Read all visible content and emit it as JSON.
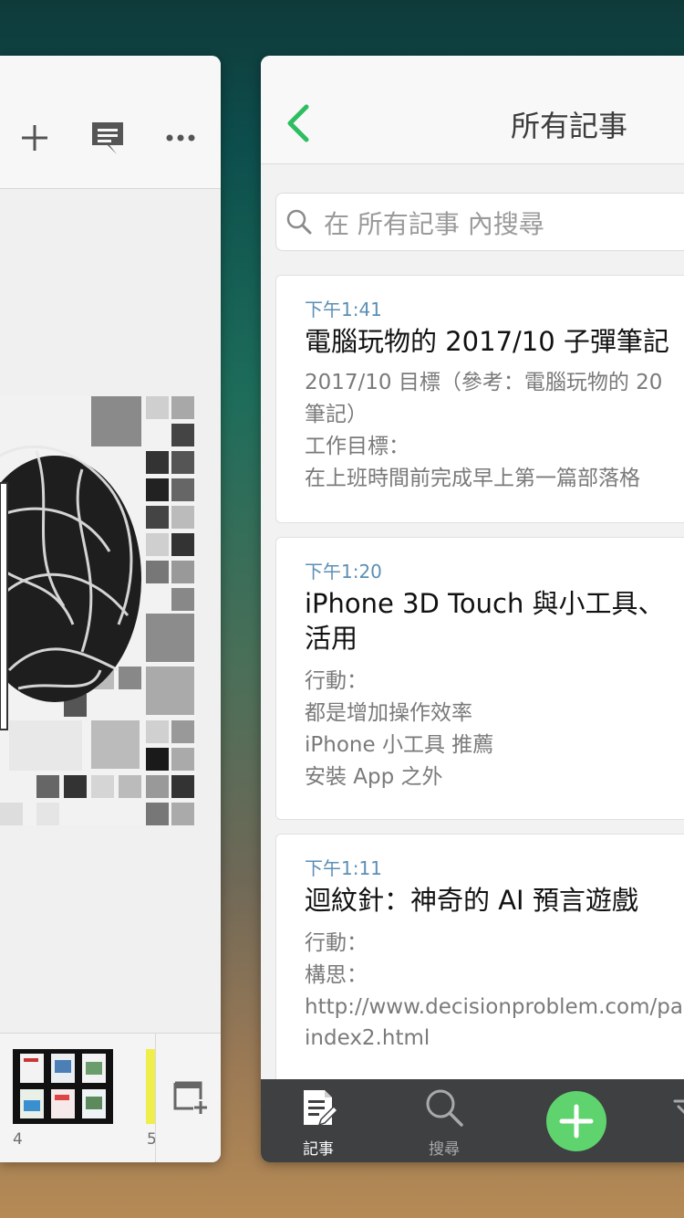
{
  "left_app": {
    "toolbar_icons": [
      "plus-icon",
      "comment-icon",
      "more-icon"
    ],
    "bottom": {
      "page_labels": [
        "4",
        "5"
      ]
    }
  },
  "right_app": {
    "nav": {
      "title": "所有記事"
    },
    "search": {
      "placeholder": "在 所有記事 內搜尋"
    },
    "notes": [
      {
        "time": "下午1:41",
        "title": "電腦玩物的 2017/10 子彈筆記",
        "lines": [
          "2017/10 目標（參考：電腦玩物的 20",
          "筆記）",
          "工作目標：",
          "在上班時間前完成早上第一篇部落格"
        ]
      },
      {
        "time": "下午1:20",
        "title_lines": [
          "iPhone 3D Touch 與小工具、",
          "活用"
        ],
        "lines": [
          "行動：",
          "都是增加操作效率",
          "iPhone 小工具 推薦",
          "安裝 App 之外"
        ]
      },
      {
        "time": "下午1:11",
        "title": "迴紋針：神奇的 AI 預言遊戲",
        "lines": [
          "行動：",
          "構思：",
          "http://www.decisionproblem.com/pa",
          "index2.html"
        ]
      }
    ],
    "tabbar": {
      "tabs": [
        {
          "label": "記事",
          "icon": "notes-icon"
        },
        {
          "label": "搜尋",
          "icon": "search-icon"
        }
      ],
      "colors": {
        "active": "#ffffff",
        "inactive": "#a7a9ab",
        "accent": "#5fd36d"
      }
    }
  }
}
